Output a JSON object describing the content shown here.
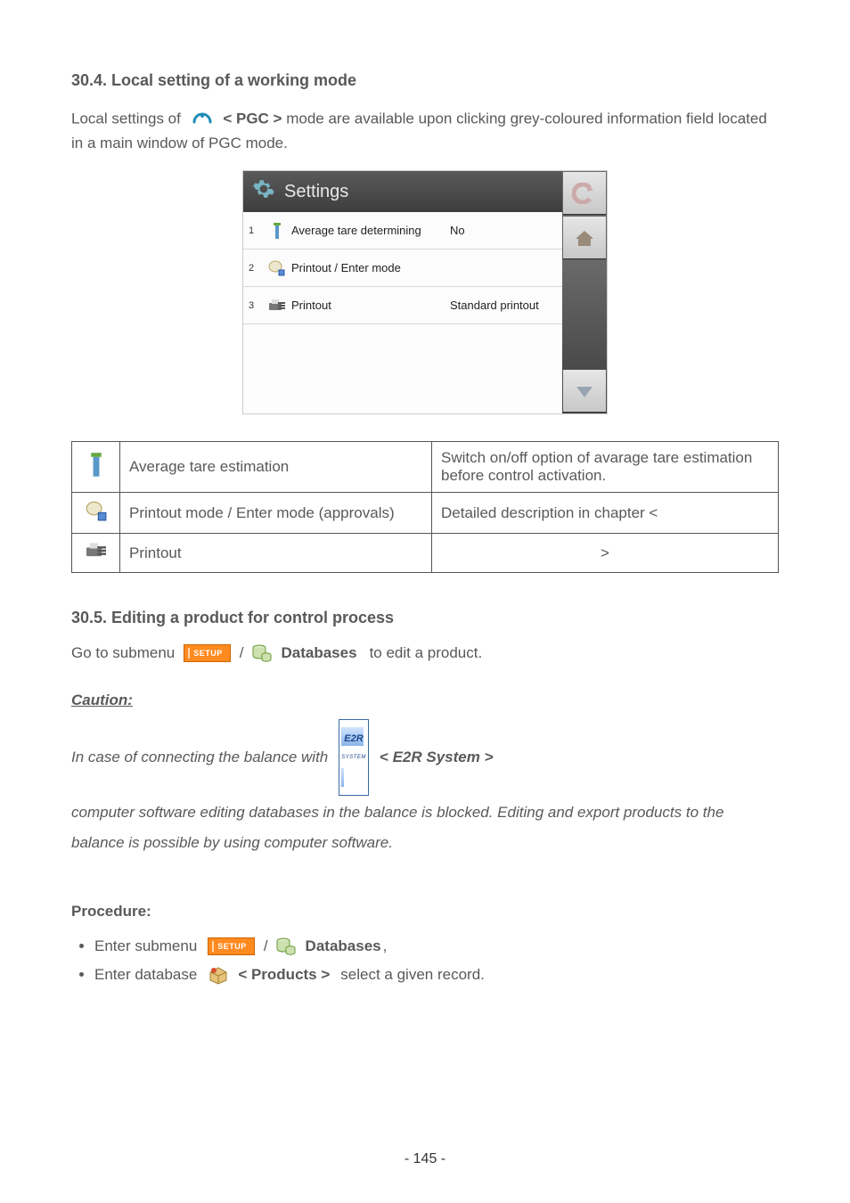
{
  "section1": {
    "heading": "30.4. Local setting of a working mode",
    "para_pre": "Local settings of",
    "para_mid": "< PGC >",
    "para_post": "mode are available upon clicking grey-coloured information field located in a main window of PGC mode."
  },
  "settings_shot": {
    "title": "Settings",
    "rows": [
      {
        "num": "1",
        "label": "Average tare determining",
        "value": "No"
      },
      {
        "num": "2",
        "label": "Printout / Enter mode",
        "value": ""
      },
      {
        "num": "3",
        "label": "Printout",
        "value": "Standard printout"
      }
    ]
  },
  "desc_table": {
    "rows": [
      {
        "name": "Average tare estimation",
        "desc": "Switch on/off option of avarage tare estimation before control activation."
      },
      {
        "name": "Printout mode / Enter mode (approvals)",
        "desc": "Detailed description in chapter <"
      },
      {
        "name": "Printout",
        "desc": ">"
      }
    ]
  },
  "section2": {
    "heading": "30.5. Editing a product for control process",
    "line1_pre": "Go to submenu",
    "setup_label": "SETUP",
    "line1_slash": "/",
    "line1_db": "Databases",
    "line1_post": "to edit a product.",
    "caution_label": "Caution:",
    "caution_pre": "In case of connecting the balance with",
    "caution_mid": "< E2R System >",
    "caution_post": "computer software editing databases in the balance is blocked. Editing and export products to the balance is possible by using computer software.",
    "proc_label": "Procedure:",
    "bullets": [
      {
        "pre": "Enter submenu",
        "mid_setup": "SETUP",
        "slash": "/",
        "db": "Databases",
        "tail": ","
      },
      {
        "pre": "Enter database",
        "prod": "< Products >",
        "tail": "select a given record."
      }
    ]
  },
  "footer": "- 145 -"
}
